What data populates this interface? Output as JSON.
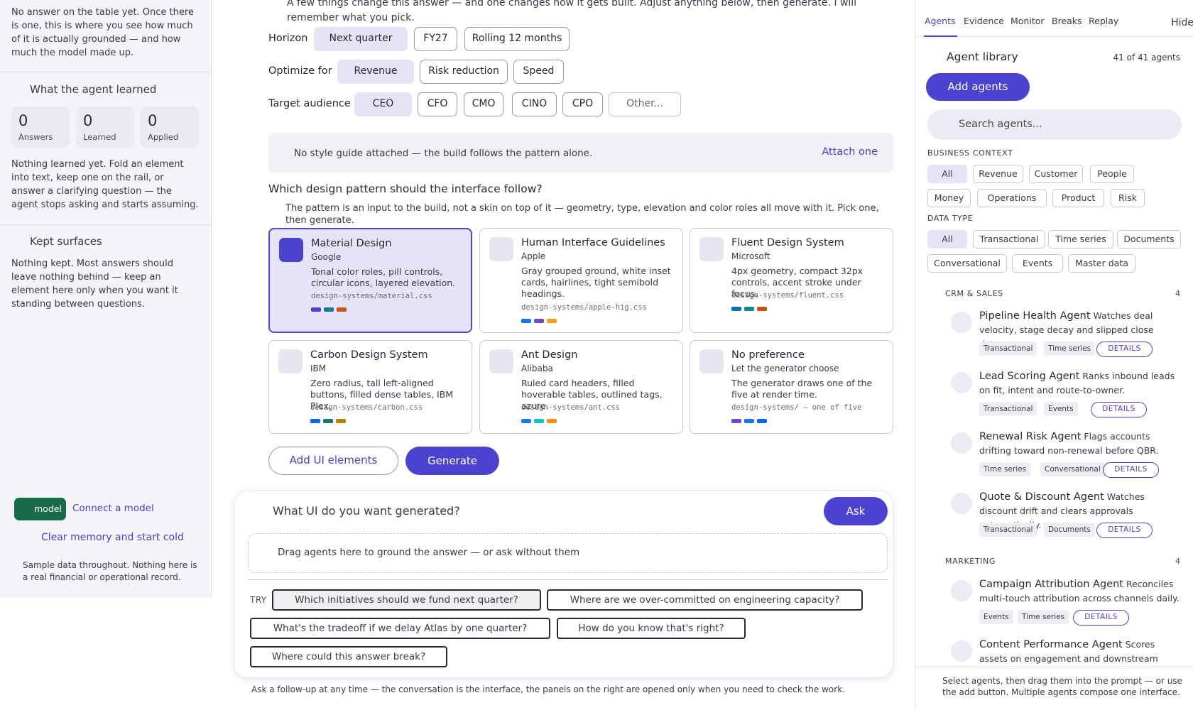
{
  "left": {
    "intro": "No answer on the table yet. Once there is one, this is where you see how much of it is actually grounded — and how much the model made up.",
    "learned_title": "What the agent learned",
    "stats": [
      {
        "num": "0",
        "label": "Answers"
      },
      {
        "num": "0",
        "label": "Learned"
      },
      {
        "num": "0",
        "label": "Applied"
      }
    ],
    "learned_text": "Nothing learned yet. Fold an element into text, keep one on the rail, or answer a clarifying question — the agent stops asking and starts assuming.",
    "kept_title": "Kept surfaces",
    "kept_text": "Nothing kept. Most answers should leave nothing behind — keep an element here only when you want it standing between questions.",
    "model_label": "model",
    "connect_label": "Connect a model",
    "clear_label": "Clear memory and start cold",
    "sample_note": "Sample data throughout. Nothing here is a real financial or operational record."
  },
  "main": {
    "cut_text": "A few things change this answer — and one changes how it gets built. Adjust anything below, then generate. I will\nremember what you pick.",
    "horizon": {
      "label": "Horizon",
      "options": [
        "Next quarter",
        "FY27",
        "Rolling 12 months"
      ]
    },
    "optimize": {
      "label": "Optimize for",
      "options": [
        "Revenue",
        "Risk reduction",
        "Speed"
      ]
    },
    "audience": {
      "label": "Target audience",
      "options": [
        "CEO",
        "CFO",
        "CMO",
        "CINO",
        "CPO",
        "Other..."
      ]
    },
    "style_msg": "No style guide attached — the build follows the pattern alone.",
    "attach_label": "Attach one",
    "pattern_question": "Which design pattern should the interface follow?",
    "pattern_sub": "The pattern is an input to the build, not a skin on top of it — geometry, type, elevation and color roles all move with it. Pick one, then generate.",
    "patterns": [
      {
        "name": "Material Design",
        "org": "Google",
        "desc": "Tonal color roles, pill controls, circular icons, layered elevation.",
        "path": "design-systems/material.css",
        "colors": [
          "#4c42d0",
          "#0f7a8a",
          "#c8520e"
        ]
      },
      {
        "name": "Human Interface Guidelines",
        "org": "Apple",
        "desc": "Gray grouped ground, white inset cards, hairlines, tight semibold headings.",
        "path": "design-systems/apple-hig.css",
        "colors": [
          "#1a73e8",
          "#6a4bd0",
          "#f0a020"
        ]
      },
      {
        "name": "Fluent Design System",
        "org": "Microsoft",
        "desc": "4px geometry, compact 32px controls, accent stroke under focus.",
        "path": "design-systems/fluent.css",
        "colors": [
          "#0f6cbd",
          "#0f8a8a",
          "#c8520e"
        ]
      },
      {
        "name": "Carbon Design System",
        "org": "IBM",
        "desc": "Zero radius, tall left-aligned buttons, filled dense tables, IBM Plex.",
        "path": "design-systems/carbon.css",
        "colors": [
          "#0f62fe",
          "#0f7a6a",
          "#b28600"
        ]
      },
      {
        "name": "Ant Design",
        "org": "Alibaba",
        "desc": "Ruled card headers, filled hoverable tables, outlined tags, azure.",
        "path": "design-systems/ant.css",
        "colors": [
          "#1677ff",
          "#13c2c2",
          "#fa8c16"
        ]
      },
      {
        "name": "No preference",
        "org": "Let the generator choose",
        "desc": "The generator draws one of the five at render time.",
        "path": "design-systems/ — one of five",
        "colors": [
          "#6a4bd0",
          "#1a73e8",
          "#0f62fe"
        ]
      }
    ],
    "add_elements_label": "Add UI elements",
    "generate_label": "Generate",
    "prompt_title": "What UI do you want generated?",
    "ask_label": "Ask",
    "drop_hint": "Drag agents here to ground the answer — or ask without them",
    "try_label": "TRY",
    "suggestions": [
      "Which initiatives should we fund next quarter?",
      "Where are we over-committed on engineering capacity?",
      "What's the tradeoff if we delay Atlas by one quarter?",
      "How do you know that's right?",
      "Where could this answer break?"
    ],
    "footnote": "Ask a follow-up at any time — the conversation is the interface, the panels on the right are opened only when you need to check the work."
  },
  "right": {
    "tabs": [
      "Agents",
      "Evidence",
      "Monitor",
      "Breaks",
      "Replay"
    ],
    "hide_label": "Hide",
    "library_title": "Agent library",
    "library_count": "41 of 41 agents",
    "add_agents_label": "Add agents",
    "search_placeholder": "Search agents...",
    "business_caption": "BUSINESS CONTEXT",
    "business_tags": [
      "All",
      "Revenue",
      "Customer",
      "People",
      "Money",
      "Operations",
      "Product",
      "Risk"
    ],
    "datatype_caption": "DATA TYPE",
    "datatype_tags": [
      "All",
      "Transactional",
      "Time series",
      "Documents",
      "Conversational",
      "Events",
      "Master data"
    ],
    "groups": [
      {
        "name": "CRM & SALES",
        "count": "4"
      },
      {
        "name": "MARKETING",
        "count": "4"
      }
    ],
    "agents": [
      {
        "name": "Pipeline Health Agent",
        "desc": "Watches deal velocity, stage decay and slipped close dates.",
        "tags": [
          "Transactional",
          "Time series"
        ]
      },
      {
        "name": "Lead Scoring Agent",
        "desc": "Ranks inbound leads on fit, intent and route-to-owner.",
        "tags": [
          "Transactional",
          "Events"
        ]
      },
      {
        "name": "Renewal Risk Agent",
        "desc": "Flags accounts drifting toward non-renewal before QBR.",
        "tags": [
          "Time series",
          "Conversational"
        ]
      },
      {
        "name": "Quote & Discount Agent",
        "desc": "Watches discount drift and clears approvals automatically.",
        "tags": [
          "Transactional",
          "Documents"
        ]
      },
      {
        "name": "Campaign Attribution Agent",
        "desc": "Reconciles multi-touch attribution across channels daily.",
        "tags": [
          "Events",
          "Time series"
        ]
      },
      {
        "name": "Content Performance Agent",
        "desc": "Scores assets on engagement and downstream influence.",
        "tags": []
      }
    ],
    "details_label": "DETAILS",
    "footer": "Select agents, then drag them into the prompt — or use the add button. Multiple agents compose one interface."
  }
}
